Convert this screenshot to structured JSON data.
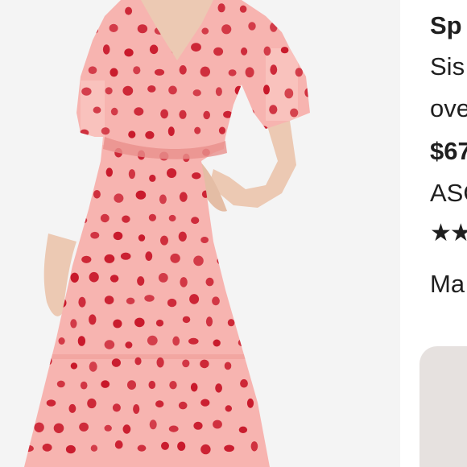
{
  "product": {
    "image_alt": "product-photo",
    "title": "Sp",
    "seller": "Sis",
    "description": "ove",
    "price": "$67",
    "sku": "ASO",
    "rating_stars": "★★",
    "more_link": "Ma"
  },
  "colors": {
    "dress_pink": "#f7b4b0",
    "dot_red": "#c8182a",
    "skin": "#ecc9b3",
    "background": "#f2f2f2",
    "star": "#f2b01e"
  }
}
